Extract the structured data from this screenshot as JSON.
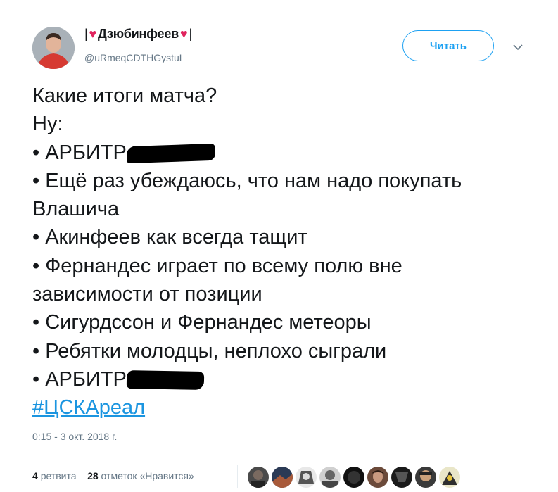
{
  "user": {
    "name_prefix": "|",
    "name": "Дзюбинфеев",
    "name_suffix": "|",
    "handle": "@uRmeqCDTHGystuL"
  },
  "follow_button": {
    "label": "Читать"
  },
  "tweet": {
    "lines": [
      "Какие итоги матча?",
      "Ну:",
      "• АРБИТР",
      "• Ещё раз убеждаюсь, что нам надо покупать Влашича",
      "• Акинфеев как всегда тащит",
      "• Фернандес играет по всему полю вне зависимости от позиции",
      "• Сигурдссон и Фернандес метеоры",
      "• Ребятки молодцы, неплохо сыграли",
      "• АРБИТР"
    ],
    "hashtag": "#ЦСКАреал"
  },
  "timestamp": "0:15 - 3 окт. 2018 г.",
  "stats": {
    "retweets_count": "4",
    "retweets_label": "ретвита",
    "likes_count": "28",
    "likes_label": "отметок «Нравится»"
  },
  "colors": {
    "accent": "#1da1f2",
    "hashtag": "#1b95e0",
    "heart": "#e0245e",
    "secondary_text": "#657786"
  }
}
